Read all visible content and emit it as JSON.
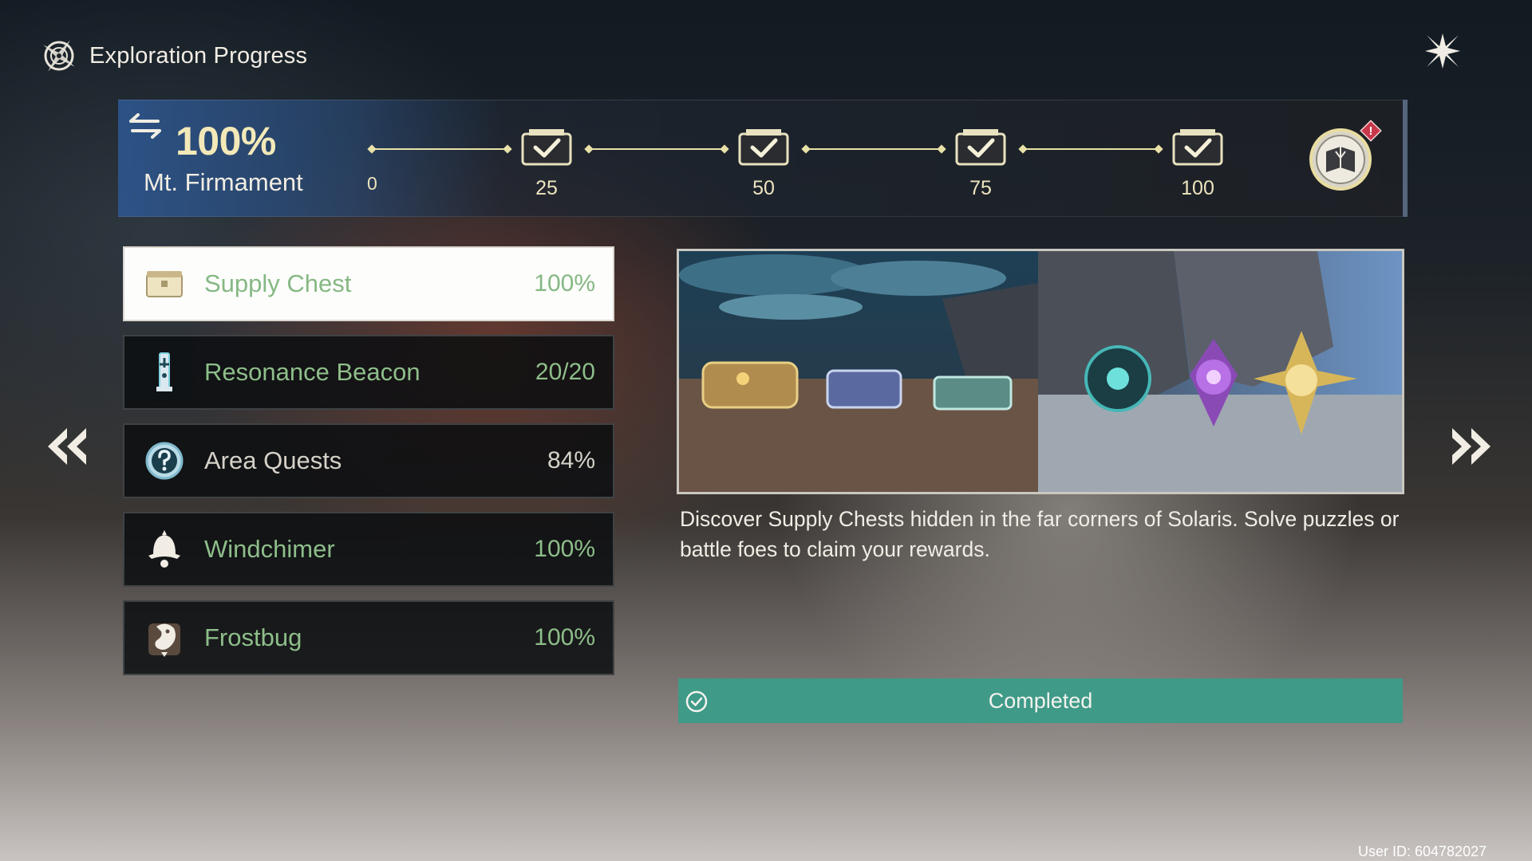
{
  "header": {
    "title": "Exploration Progress"
  },
  "banner": {
    "percent": "100%",
    "region": "Mt. Firmament",
    "start_label": "0",
    "milestones": [
      {
        "label": "25",
        "claimed": true
      },
      {
        "label": "50",
        "claimed": true
      },
      {
        "label": "75",
        "claimed": true
      },
      {
        "label": "100",
        "claimed": true
      }
    ],
    "alert_badge": "!"
  },
  "categories": [
    {
      "name": "Supply Chest",
      "value": "100%",
      "icon": "chest-icon",
      "selected": true
    },
    {
      "name": "Resonance Beacon",
      "value": "20/20",
      "icon": "beacon-icon",
      "selected": false
    },
    {
      "name": "Area Quests",
      "value": "84%",
      "icon": "question-icon",
      "selected": false
    },
    {
      "name": "Windchimer",
      "value": "100%",
      "icon": "windchimer-icon",
      "selected": false
    },
    {
      "name": "Frostbug",
      "value": "100%",
      "icon": "frostbug-icon",
      "selected": false
    }
  ],
  "detail": {
    "description": "Discover Supply Chests hidden in the far corners of Solaris. Solve puzzles or battle foes to claim your rewards.",
    "status": "Completed"
  },
  "footer": {
    "user_id": "User ID: 604782027"
  },
  "colors": {
    "accent_green": "#3f9a88",
    "complete_text": "#8ebe8a",
    "milestone_gold": "#ece4bf"
  }
}
